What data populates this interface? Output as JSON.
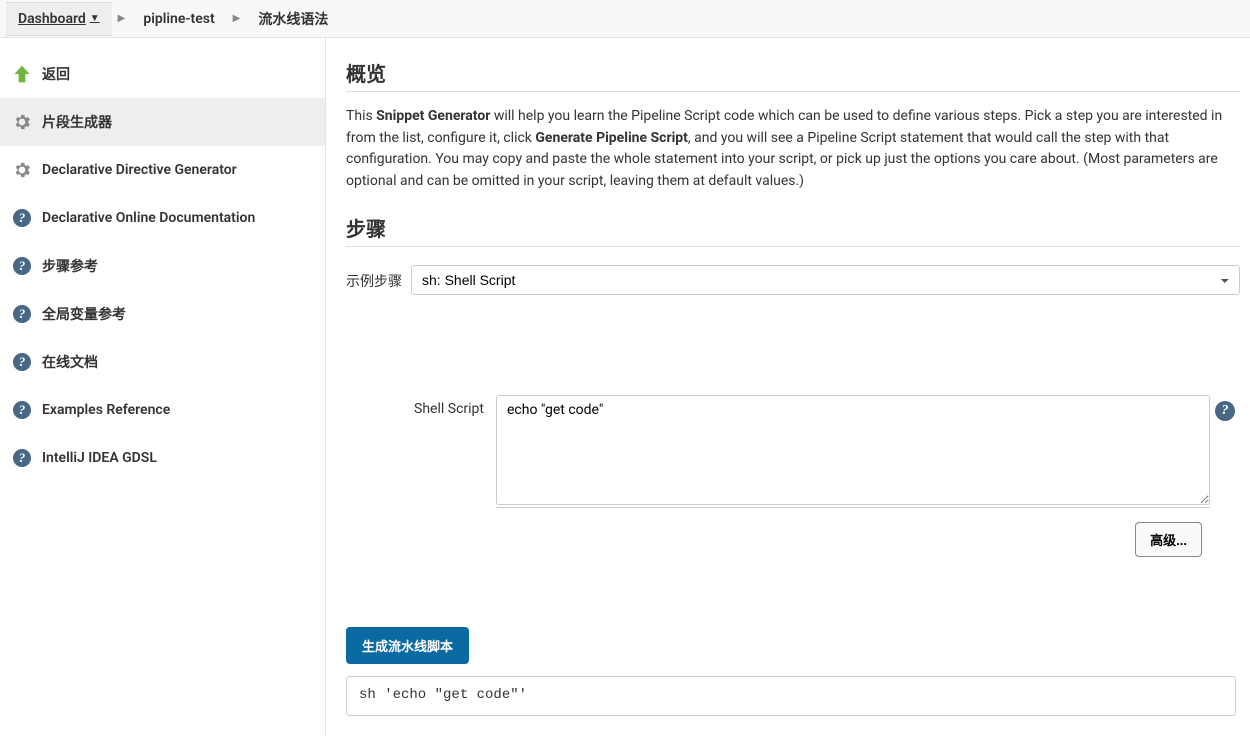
{
  "breadcrumbs": {
    "dashboard": "Dashboard",
    "job": "pipline-test",
    "page": "流水线语法"
  },
  "sidebar": {
    "items": [
      {
        "label": "返回",
        "icon": "arrow-up"
      },
      {
        "label": "片段生成器",
        "icon": "gear",
        "active": true
      },
      {
        "label": "Declarative Directive Generator",
        "icon": "gear"
      },
      {
        "label": "Declarative Online Documentation",
        "icon": "help"
      },
      {
        "label": "步骤参考",
        "icon": "help"
      },
      {
        "label": "全局变量参考",
        "icon": "help"
      },
      {
        "label": "在线文档",
        "icon": "help"
      },
      {
        "label": "Examples Reference",
        "icon": "help"
      },
      {
        "label": "IntelliJ IDEA GDSL",
        "icon": "help"
      }
    ]
  },
  "overview": {
    "heading": "概览",
    "desc_part1": "This ",
    "desc_bold1": "Snippet Generator",
    "desc_part2": " will help you learn the Pipeline Script code which can be used to define various steps. Pick a step you are interested in from the list, configure it, click ",
    "desc_bold2": "Generate Pipeline Script",
    "desc_part3": ", and you will see a Pipeline Script statement that would call the step with that configuration. You may copy and paste the whole statement into your script, or pick up just the options you care about. (Most parameters are optional and can be omitted in your script, leaving them at default values.)"
  },
  "steps": {
    "heading": "步骤",
    "sample_step_label": "示例步骤",
    "sample_step_value": "sh: Shell Script",
    "shell_script_label": "Shell Script",
    "shell_script_value": "echo \"get code\"",
    "advanced_button": "高级...",
    "generate_button": "生成流水线脚本",
    "output": "sh 'echo \"get code\"'"
  }
}
